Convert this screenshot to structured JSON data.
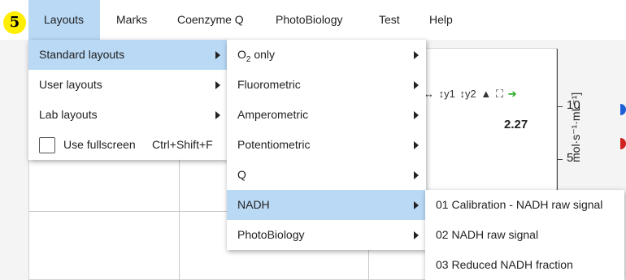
{
  "step_badge": "5",
  "menubar": {
    "items": [
      "Layouts",
      "Marks",
      "Coenzyme Q",
      "PhotoBiology",
      "Test",
      "Help"
    ]
  },
  "background": {
    "toolbar_glyphs": [
      "↔",
      "↕y1",
      "↕y2",
      "▲",
      "⛶",
      "➔"
    ],
    "readout": "2.27",
    "axis_ticks": [
      "10",
      "5"
    ],
    "axis_label": "mol·s⁻¹·mL⁻¹]",
    "colors": {
      "dot_blue": "#1f5fd6",
      "dot_red": "#d02020"
    }
  },
  "layouts_menu": {
    "items": [
      {
        "label": "Standard layouts",
        "submenu": true
      },
      {
        "label": "User layouts",
        "submenu": true
      },
      {
        "label": "Lab layouts",
        "submenu": true
      },
      {
        "label": "Use fullscreen",
        "checkbox": true,
        "checked": false,
        "shortcut": "Ctrl+Shift+F"
      }
    ]
  },
  "standard_layouts_menu": {
    "o2_prefix": "O",
    "o2_sub": "2",
    "o2_suffix": " only",
    "items": [
      {
        "label": "Fluorometric"
      },
      {
        "label": "Amperometric"
      },
      {
        "label": "Potentiometric"
      },
      {
        "label": "Q"
      },
      {
        "label": "NADH"
      },
      {
        "label": "PhotoBiology"
      }
    ]
  },
  "nadh_menu": {
    "items": [
      {
        "label": "01 Calibration - NADH raw signal"
      },
      {
        "label": "02 NADH raw signal"
      },
      {
        "label": "03 Reduced NADH fraction"
      }
    ]
  },
  "theme": {
    "highlight": "#b9d9f5",
    "badge": "#ffee00"
  }
}
